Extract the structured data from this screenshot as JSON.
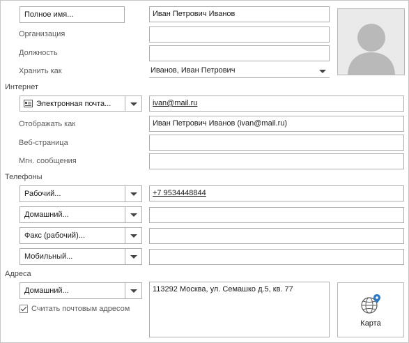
{
  "name": {
    "button_label": "Полное имя...",
    "full_name_value": "Иван Петрович Иванов",
    "organization_label": "Организация",
    "organization_value": "",
    "position_label": "Должность",
    "position_value": "",
    "file_as_label": "Хранить как",
    "file_as_value": "Иванов, Иван Петрович"
  },
  "internet": {
    "section_label": "Интернет",
    "email_button_label": "Электронная почта...",
    "email_value": "ivan@mail.ru",
    "display_as_label": "Отображать как",
    "display_as_value": "Иван Петрович Иванов (ivan@mail.ru)",
    "web_page_label": "Веб-страница",
    "web_page_value": "",
    "im_label": "Мгн. сообщения",
    "im_value": ""
  },
  "phones": {
    "section_label": "Телефоны",
    "items": [
      {
        "label": "Рабочий...",
        "value": "+7 9534448844"
      },
      {
        "label": "Домашний...",
        "value": ""
      },
      {
        "label": "Факс (рабочий)...",
        "value": ""
      },
      {
        "label": "Мобильный...",
        "value": ""
      }
    ]
  },
  "addresses": {
    "section_label": "Адреса",
    "type_label": "Домашний...",
    "address_value": "113292 Москва, ул. Семашко д.5, кв. 77",
    "mailing_checkbox_label": "Считать почтовым адресом",
    "mailing_checked": true,
    "map_button_label": "Карта"
  },
  "icons": {
    "photo": "contact-photo-placeholder",
    "email": "address-card-icon",
    "map": "globe-pin-icon",
    "accent_color": "#2b79c2"
  }
}
